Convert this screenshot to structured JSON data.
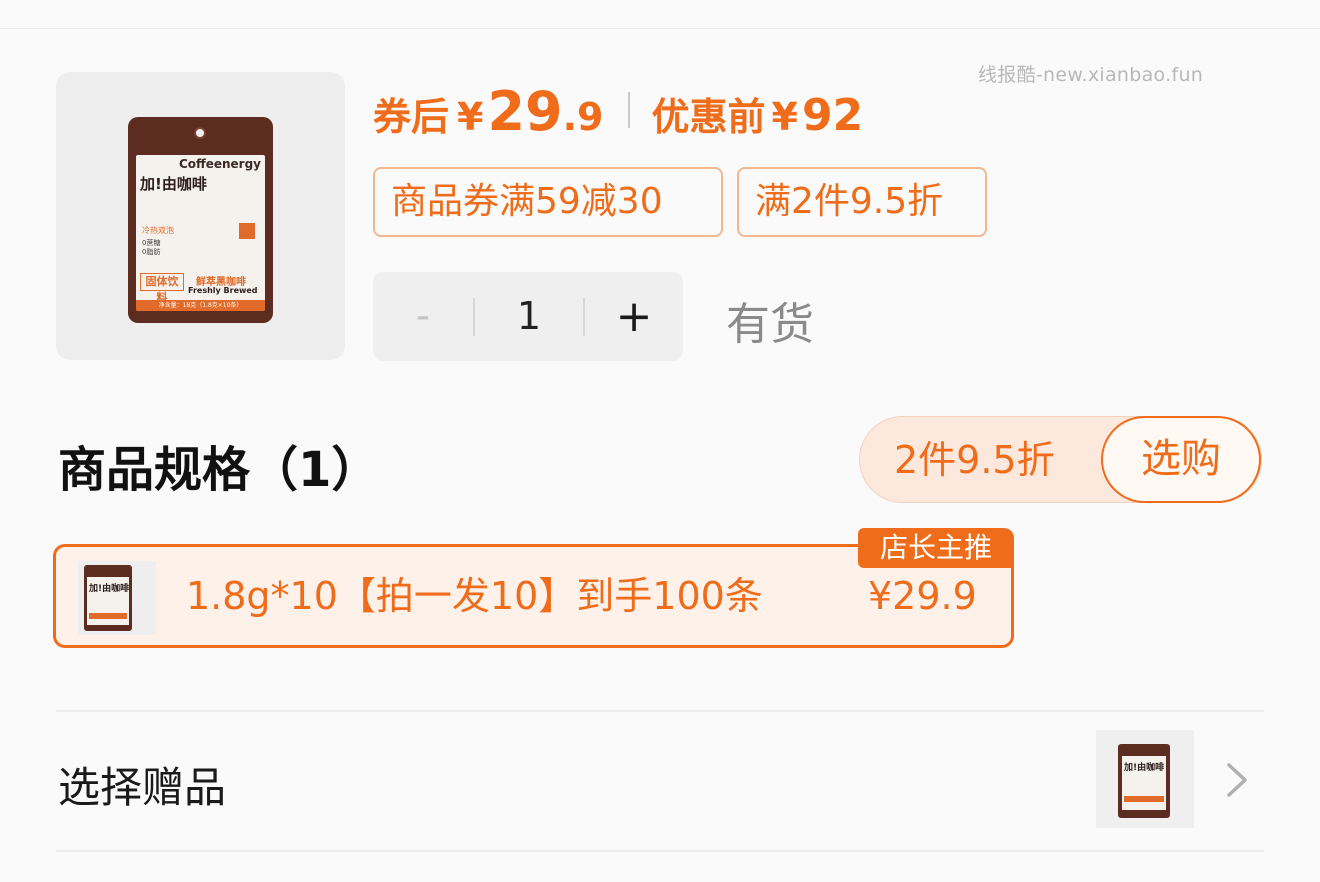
{
  "watermark": "线报酷-new.xianbao.fun",
  "product": {
    "image_name": "coffee-pouch",
    "pouch_brand_en": "Coffeenergy",
    "pouch_brand_cn": "加!由咖啡",
    "pouch_hotcold": "冷热双泡",
    "pouch_notes": "0蔗糖\n0脂肪",
    "pouch_type": "固体饮料",
    "pouch_product": "鲜萃黑咖啡",
    "pouch_brewed": "Freshly Brewed",
    "pouch_net": "净含量：18克（1.8克×10条）"
  },
  "price": {
    "after_label": "券后",
    "currency": "¥",
    "after_int": "29",
    "after_dec": ".9",
    "before_label": "优惠前",
    "before_value": "92"
  },
  "coupons": [
    "商品券满59减30",
    "满2件9.5折"
  ],
  "quantity": {
    "minus": "-",
    "value": "1",
    "plus": "+",
    "stock": "有货"
  },
  "spec": {
    "title": "商品规格（1）",
    "promo": "2件9.5折",
    "buy_label": "选购",
    "option": {
      "thumb_text": "加!由咖啡",
      "label": "1.8g*10【拍一发10】到手100条",
      "price": "¥29.9",
      "badge": "店长主推"
    }
  },
  "gift": {
    "label": "选择赠品",
    "thumb_text": "加!由咖啡"
  },
  "colors": {
    "accent": "#ef6c1a",
    "pouch": "#5b2c1f"
  }
}
